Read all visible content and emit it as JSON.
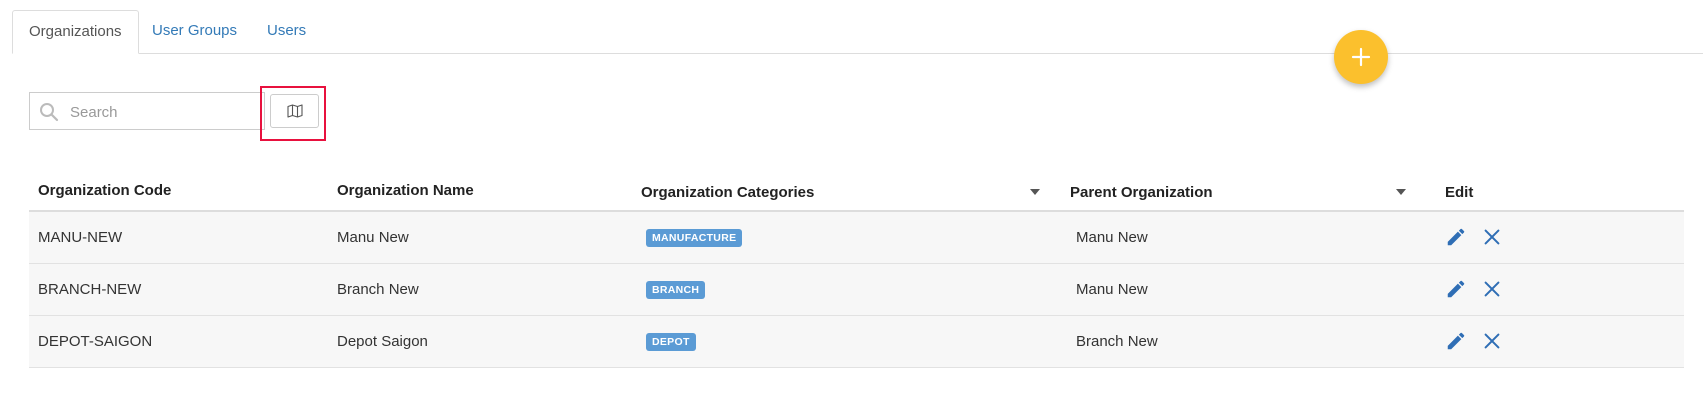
{
  "tabs": [
    {
      "label": "Organizations",
      "active": true
    },
    {
      "label": "User Groups",
      "active": false
    },
    {
      "label": "Users",
      "active": false
    }
  ],
  "fab": {
    "icon": "plus-icon",
    "color": "#fbc02d"
  },
  "search": {
    "placeholder": "Search",
    "value": ""
  },
  "map_button": {
    "icon": "map-icon"
  },
  "table": {
    "headers": {
      "code": "Organization Code",
      "name": "Organization Name",
      "categories": "Organization Categories",
      "parent": "Parent Organization",
      "edit": "Edit"
    },
    "rows": [
      {
        "code": "MANU-NEW",
        "name": "Manu New",
        "category": "MANUFACTURE",
        "parent": "Manu New"
      },
      {
        "code": "BRANCH-NEW",
        "name": "Branch New",
        "category": "BRANCH",
        "parent": "Manu New"
      },
      {
        "code": "DEPOT-SAIGON",
        "name": "Depot Saigon",
        "category": "DEPOT",
        "parent": "Branch New"
      }
    ]
  },
  "colors": {
    "accent": "#337ab7",
    "badge": "#5b9bd5",
    "highlight": "#e8113e"
  }
}
